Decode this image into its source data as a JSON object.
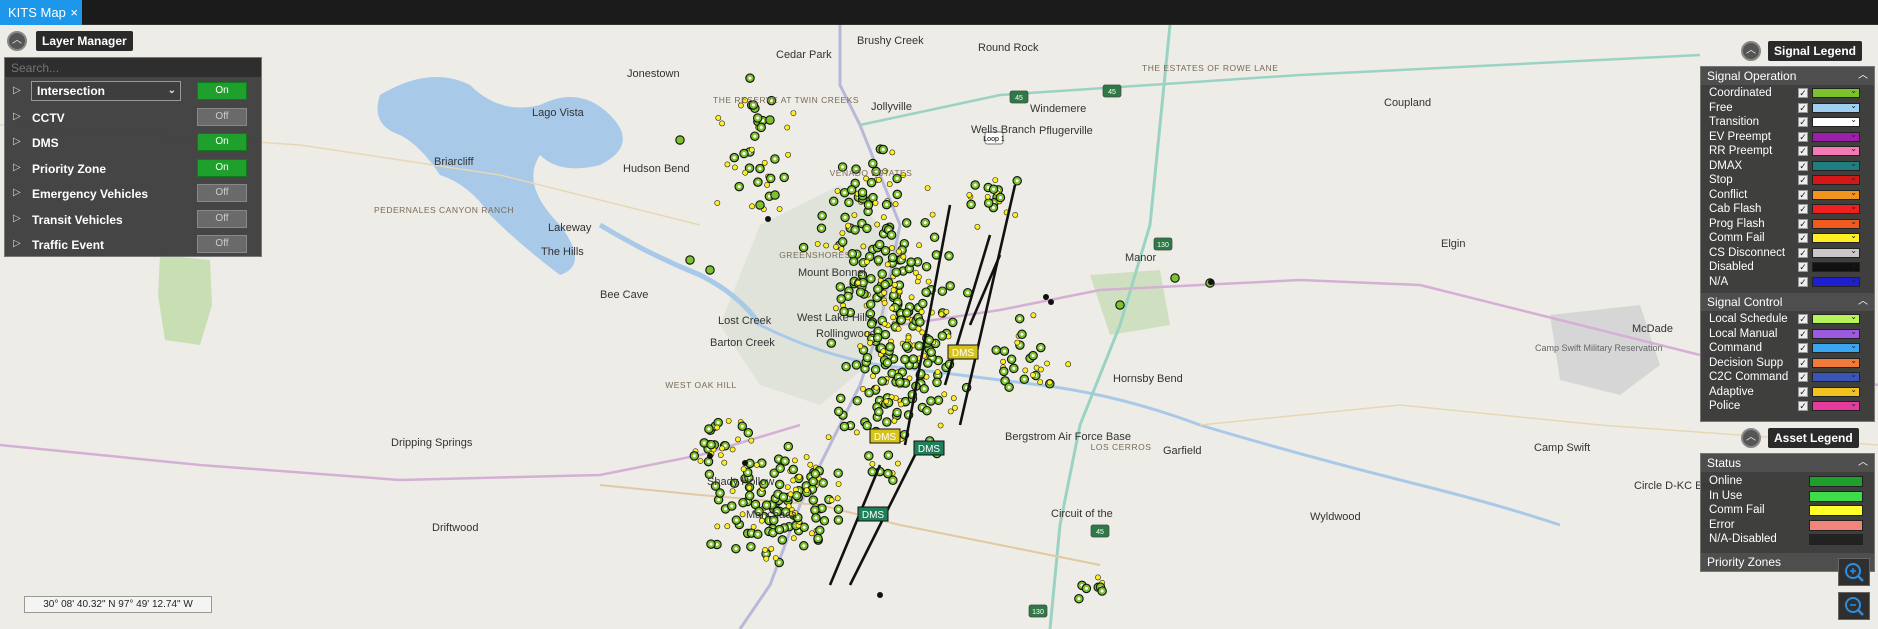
{
  "tab": {
    "title": "KITS Map",
    "close": "×"
  },
  "layer_manager": {
    "title": "Layer Manager",
    "search_placeholder": "Search...",
    "rows": [
      {
        "label": "Intersection",
        "state": "On",
        "dropdown": true
      },
      {
        "label": "CCTV",
        "state": "Off"
      },
      {
        "label": "DMS",
        "state": "On"
      },
      {
        "label": "Priority Zone",
        "state": "On"
      },
      {
        "label": "Emergency Vehicles",
        "state": "Off"
      },
      {
        "label": "Transit Vehicles",
        "state": "Off"
      },
      {
        "label": "Traffic Event",
        "state": "Off"
      }
    ]
  },
  "signal_legend": {
    "title": "Signal Legend",
    "sections": [
      {
        "name": "Signal Operation",
        "items": [
          {
            "label": "Coordinated",
            "color": "#7cc22a"
          },
          {
            "label": "Free",
            "color": "#9fd0f2"
          },
          {
            "label": "Transition",
            "color": "#ffffff"
          },
          {
            "label": "EV Preempt",
            "color": "#9b1fa8"
          },
          {
            "label": "RR Preempt",
            "color": "#f27bb6"
          },
          {
            "label": "DMAX",
            "color": "#1f7f80"
          },
          {
            "label": "Stop",
            "color": "#d41818"
          },
          {
            "label": "Conflict",
            "color": "#f0941e"
          },
          {
            "label": "Cab Flash",
            "color": "#ee2020"
          },
          {
            "label": "Prog Flash",
            "color": "#f05a1e"
          },
          {
            "label": "Comm Fail",
            "color": "#ffee22"
          },
          {
            "label": "CS Disconnect",
            "color": "#c8c8c8"
          },
          {
            "label": "Disabled",
            "color": "#111111"
          },
          {
            "label": "N/A",
            "color": "#1f1fd0"
          }
        ]
      },
      {
        "name": "Signal Control",
        "items": [
          {
            "label": "Local Schedule",
            "color": "#b6f25a"
          },
          {
            "label": "Local Manual",
            "color": "#9d5ae0"
          },
          {
            "label": "Command",
            "color": "#3aa6f2"
          },
          {
            "label": "Decision Supp",
            "color": "#f07a3a"
          },
          {
            "label": "C2C Command",
            "color": "#3a55b8"
          },
          {
            "label": "Adaptive",
            "color": "#f2c21e"
          },
          {
            "label": "Police",
            "color": "#e63a9e"
          }
        ]
      }
    ]
  },
  "asset_legend": {
    "title": "Asset Legend",
    "section": "Status",
    "items": [
      {
        "label": "Online",
        "color": "#1fa02d"
      },
      {
        "label": "In Use",
        "color": "#3ddc48"
      },
      {
        "label": "Comm Fail",
        "color": "#ffff2a"
      },
      {
        "label": "Error",
        "color": "#f2857a"
      },
      {
        "label": "N/A-Disabled",
        "color": "#222222"
      }
    ],
    "priority_zones": "Priority Zones"
  },
  "coordinates": "30° 08' 40.32\" N 97° 49' 12.74\" W",
  "places": [
    {
      "name": "Cedar Park"
    },
    {
      "name": "Brushy Creek"
    },
    {
      "name": "Round Rock"
    },
    {
      "name": "Jonestown"
    },
    {
      "name": "Jollyville"
    },
    {
      "name": "Pflugerville"
    },
    {
      "name": "Coupland"
    },
    {
      "name": "Lago Vista"
    },
    {
      "name": "Briarcliff"
    },
    {
      "name": "Hudson Bend"
    },
    {
      "name": "Lakeway"
    },
    {
      "name": "The Hills"
    },
    {
      "name": "Bee Cave"
    },
    {
      "name": "Mount Bonnel"
    },
    {
      "name": "Manor"
    },
    {
      "name": "Elgin"
    },
    {
      "name": "Lost Creek"
    },
    {
      "name": "West Lake Hills"
    },
    {
      "name": "Rollingwood"
    },
    {
      "name": "Barton Creek"
    },
    {
      "name": "Hornsby Bend"
    },
    {
      "name": "McDade"
    },
    {
      "name": "Dripping Springs"
    },
    {
      "name": "Garfield"
    },
    {
      "name": "Camp Swift"
    },
    {
      "name": "Shady Hollow"
    },
    {
      "name": "Manchaca"
    },
    {
      "name": "Circle D-KC Estates"
    },
    {
      "name": "Wyldwood"
    },
    {
      "name": "Driftwood"
    },
    {
      "name": "Wells Branch"
    },
    {
      "name": "Windemere"
    },
    {
      "name": "Bergstrom Air Force Base"
    },
    {
      "name": "Circuit of the"
    }
  ],
  "small_places": [
    {
      "name": "THE ESTATES OF ROWE LANE"
    },
    {
      "name": "THE RESERVE AT TWIN CREEKS"
    },
    {
      "name": "VENADO ESTATES"
    },
    {
      "name": "PEDERNALES CANYON RANCH"
    },
    {
      "name": "GREENSHORES"
    },
    {
      "name": "WEST OAK HILL"
    },
    {
      "name": "LOS CERROS"
    }
  ],
  "gray_places": [
    {
      "name": "Camp Swift Military Reservation"
    }
  ],
  "road_shields": [
    "45",
    "45",
    "130",
    "45",
    "130",
    "Loop 1"
  ],
  "dms_labels": [
    "DMS",
    "DMS",
    "DMS",
    "DMS"
  ]
}
